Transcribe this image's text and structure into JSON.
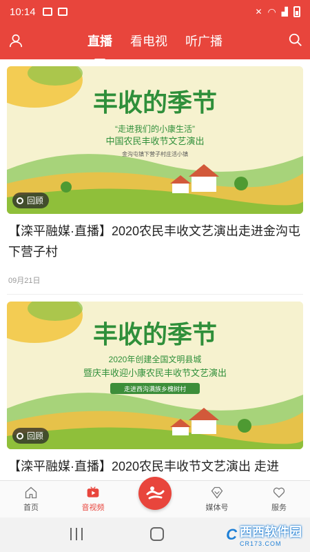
{
  "status_bar": {
    "time": "10:14"
  },
  "header": {
    "tabs": [
      {
        "label": "直播",
        "active": true
      },
      {
        "label": "看电视",
        "active": false
      },
      {
        "label": "听广播",
        "active": false
      }
    ]
  },
  "feed": [
    {
      "banner_title": "丰收的季节",
      "banner_line1": "“走进我们的小康生活”",
      "banner_line2": "中国农民丰收节文艺演出",
      "banner_line3": "金沟屯镇下营子村庄活小镇",
      "badge": "回顾",
      "title": "【滦平融媒·直播】2020农民丰收文艺演出走进金沟屯下营子村",
      "date": "09月21日"
    },
    {
      "banner_title": "丰收的季节",
      "banner_line1": "2020年创建全国文明县城",
      "banner_line2": "暨庆丰收迎小康农民丰收节文艺演出",
      "banner_line3": "走进西沟满族乡槐树村",
      "badge": "回顾",
      "title": "【滦平融媒·直播】2020农民丰收节文艺演出 走进"
    }
  ],
  "bottom_nav": {
    "items": [
      {
        "label": "首页",
        "icon": "home-icon",
        "active": false
      },
      {
        "label": "音视频",
        "icon": "video-icon",
        "active": true
      },
      {
        "label": "媒体号",
        "icon": "diamond-icon",
        "active": false
      },
      {
        "label": "服务",
        "icon": "heart-icon",
        "active": false
      }
    ]
  },
  "watermark": {
    "logo": "C",
    "main": "西西软件园",
    "sub": "CR173.COM"
  },
  "colors": {
    "accent": "#e8453c",
    "banner_bg": "#f4f1c9",
    "field_green": "#8fbf3a",
    "field_yellow": "#e6c24a",
    "title_green": "#2f8f3a"
  }
}
